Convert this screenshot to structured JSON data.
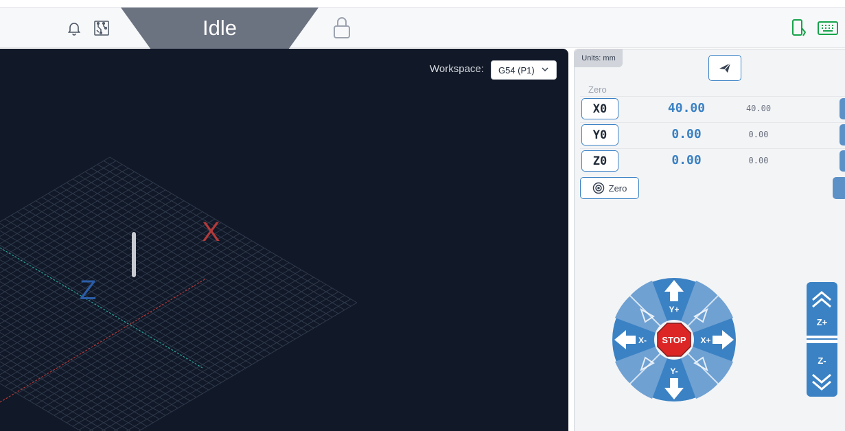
{
  "header": {
    "status": "Idle",
    "icons": {
      "notification": "bell-icon",
      "board": "circuit-board-icon",
      "lock": "lock-icon",
      "mobile": "mobile-icon",
      "keyboard": "keyboard-icon"
    }
  },
  "visualizer": {
    "workspace_label": "Workspace:",
    "workspace_value": "G54 (P1)",
    "axis_labels": {
      "x": "X",
      "z": "Z"
    }
  },
  "panel": {
    "units_badge": "Units: mm",
    "zero_heading": "Zero",
    "axes": [
      {
        "button": "X0",
        "value": "40.00",
        "machine": "40.00"
      },
      {
        "button": "Y0",
        "value": "0.00",
        "machine": "0.00"
      },
      {
        "button": "Z0",
        "value": "0.00",
        "machine": "0.00"
      }
    ],
    "zero_all_label": "Zero"
  },
  "jog": {
    "stop_label": "STOP",
    "y_plus": "Y+",
    "y_minus": "Y-",
    "x_plus": "X+",
    "x_minus": "X-",
    "z_plus": "Z+",
    "z_minus": "Z-"
  },
  "colors": {
    "accent": "#3b82c4",
    "status_bg": "#6b7280",
    "visualizer_bg": "#111827",
    "stop": "#dc2626",
    "x_axis": "#b33a3a",
    "z_axis": "#2b5ea8",
    "green_icons": "#16a34a"
  }
}
